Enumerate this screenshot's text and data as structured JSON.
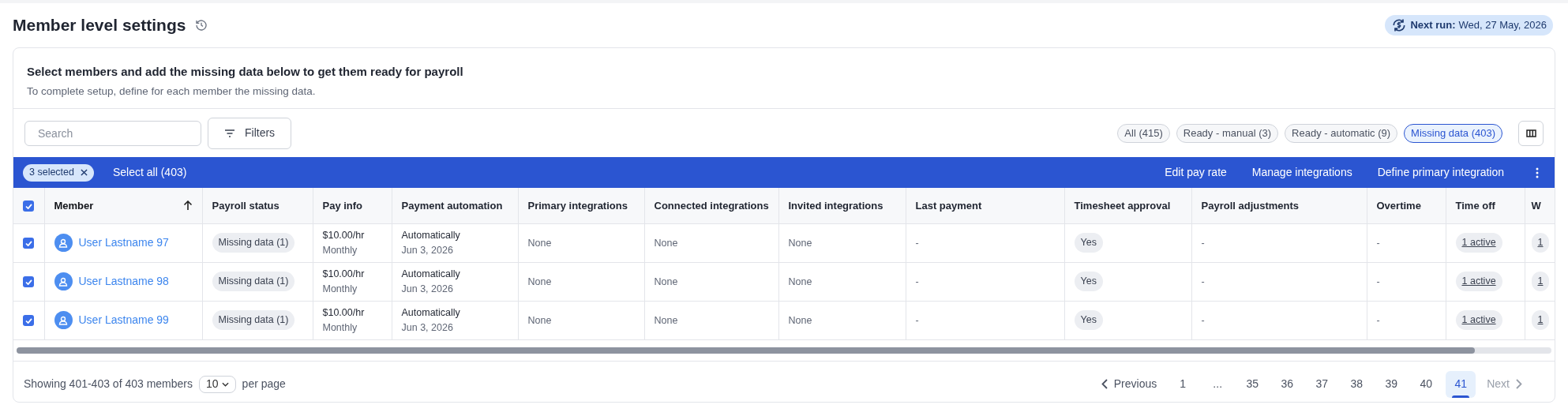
{
  "page": {
    "title": "Member level settings",
    "next_run": {
      "label": "Next run:",
      "value": "Wed, 27 May, 2026"
    }
  },
  "card": {
    "heading": "Select members and add the missing data below to get them ready for payroll",
    "subheading": "To complete setup, define for each member the missing data."
  },
  "toolbar": {
    "search": {
      "placeholder": "Search"
    },
    "filters_button": "Filters",
    "status_filters": [
      {
        "label": "All (415)",
        "selected": false
      },
      {
        "label": "Ready - manual (3)",
        "selected": false
      },
      {
        "label": "Ready - automatic (9)",
        "selected": false
      },
      {
        "label": "Missing data (403)",
        "selected": true
      }
    ]
  },
  "selection_bar": {
    "selected_chip": "3 selected",
    "select_all": "Select all (403)",
    "actions": [
      "Edit pay rate",
      "Manage integrations",
      "Define primary integration"
    ]
  },
  "table": {
    "header_checked": true,
    "columns": [
      {
        "label": "Member",
        "sorted": true
      },
      {
        "label": "Payroll status",
        "sorted": false
      },
      {
        "label": "Pay info",
        "sorted": false
      },
      {
        "label": "Payment automation",
        "sorted": false
      },
      {
        "label": "Primary integrations",
        "sorted": false
      },
      {
        "label": "Connected integrations",
        "sorted": false
      },
      {
        "label": "Invited integrations",
        "sorted": false
      },
      {
        "label": "Last payment",
        "sorted": false
      },
      {
        "label": "Timesheet approval",
        "sorted": false
      },
      {
        "label": "Payroll adjustments",
        "sorted": false
      },
      {
        "label": "Overtime",
        "sorted": false
      },
      {
        "label": "Time off",
        "sorted": false
      },
      {
        "label": "W",
        "sorted": false
      }
    ],
    "rows": [
      {
        "selected": true,
        "member": "User Lastname 97",
        "payroll_status": "Missing data (1)",
        "pay_rate": "$10.00/hr",
        "pay_period": "Monthly",
        "automation": "Automatically",
        "automation_date": "Jun 3, 2026",
        "primary_integrations": "None",
        "connected_integrations": "None",
        "invited_integrations": "None",
        "last_payment": "-",
        "timesheet_approval": "Yes",
        "payroll_adjustments": "-",
        "overtime": "-",
        "time_off": "1 active",
        "column_13": "1"
      },
      {
        "selected": true,
        "member": "User Lastname 98",
        "payroll_status": "Missing data (1)",
        "pay_rate": "$10.00/hr",
        "pay_period": "Monthly",
        "automation": "Automatically",
        "automation_date": "Jun 3, 2026",
        "primary_integrations": "None",
        "connected_integrations": "None",
        "invited_integrations": "None",
        "last_payment": "-",
        "timesheet_approval": "Yes",
        "payroll_adjustments": "-",
        "overtime": "-",
        "time_off": "1 active",
        "column_13": "1"
      },
      {
        "selected": true,
        "member": "User Lastname 99",
        "payroll_status": "Missing data (1)",
        "pay_rate": "$10.00/hr",
        "pay_period": "Monthly",
        "automation": "Automatically",
        "automation_date": "Jun 3, 2026",
        "primary_integrations": "None",
        "connected_integrations": "None",
        "invited_integrations": "None",
        "last_payment": "-",
        "timesheet_approval": "Yes",
        "payroll_adjustments": "-",
        "overtime": "-",
        "time_off": "1 active",
        "column_13": "1"
      }
    ]
  },
  "footer": {
    "showing": "Showing 401-403 of 403 members",
    "per_page_value": "10",
    "per_page_label": "per page",
    "previous": {
      "label": "Previous",
      "disabled": false
    },
    "pages": [
      {
        "label": "1",
        "selected": false
      },
      {
        "label": "...",
        "selected": false
      },
      {
        "label": "35",
        "selected": false
      },
      {
        "label": "36",
        "selected": false
      },
      {
        "label": "37",
        "selected": false
      },
      {
        "label": "38",
        "selected": false
      },
      {
        "label": "39",
        "selected": false
      },
      {
        "label": "40",
        "selected": false
      },
      {
        "label": "41",
        "selected": true
      }
    ],
    "next": {
      "label": "Next",
      "disabled": true
    }
  }
}
